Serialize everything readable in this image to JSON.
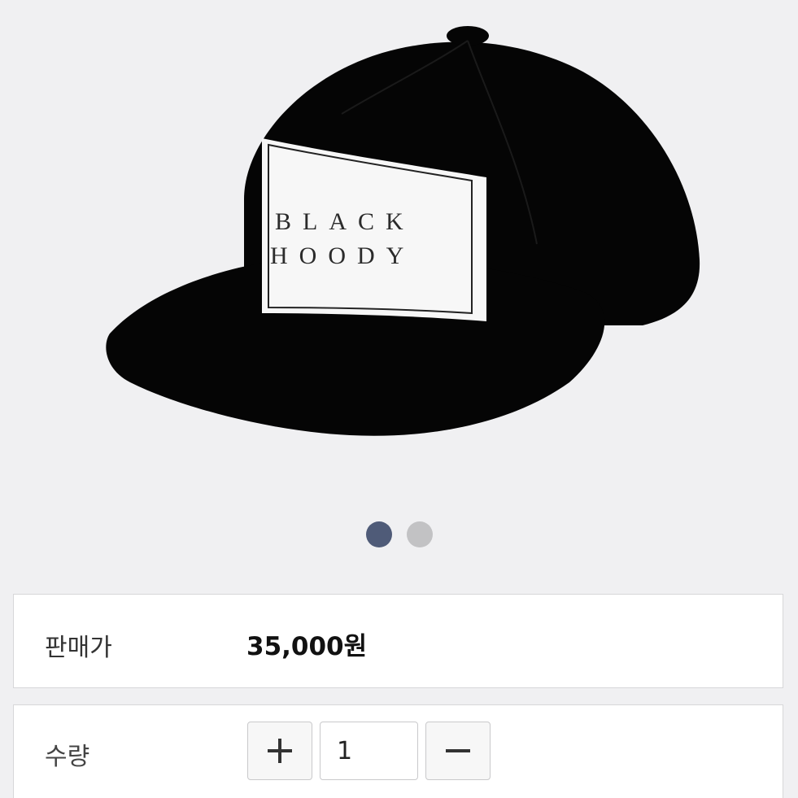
{
  "product": {
    "image_alt": "black snapback cap",
    "cap_text_line1": "BLACK",
    "cap_text_line2": "HOODY",
    "carousel": {
      "count": 2,
      "active_index": 0
    }
  },
  "price_row": {
    "label": "판매가",
    "value": "35,000원"
  },
  "quantity_row": {
    "label": "수량",
    "value": "1",
    "increase_icon": "plus-icon",
    "decrease_icon": "minus-icon"
  },
  "colors": {
    "background": "#f0f0f2",
    "dot_active": "#4f5b78",
    "dot_inactive": "#c2c2c4",
    "cap": "#050505",
    "patch": "#f7f7f7"
  }
}
